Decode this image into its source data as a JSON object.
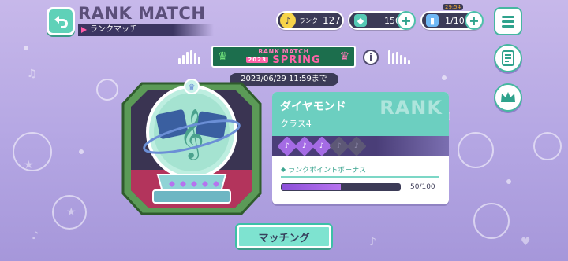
{
  "header": {
    "title": "RANK MATCH",
    "subtitle": "ランクマッチ"
  },
  "stats": {
    "rank_label": "ランク",
    "rank_value": "127",
    "crystals": "150",
    "live_bonus_timer": "29:54",
    "live_bonus": "1/10"
  },
  "season": {
    "banner_top": "RANK MATCH",
    "banner_year": "2023",
    "banner_bottom": "SPRING",
    "deadline": "2023/06/29 11:59まで"
  },
  "rank_card": {
    "watermark": "RANK",
    "tier": "ダイヤモンド",
    "class": "クラス4",
    "stars_filled": 3,
    "stars_total": 5,
    "bonus_label": "ランクポイントボーナス",
    "progress_text": "50/100",
    "progress_fraction": 0.5
  },
  "buttons": {
    "matching": "マッチング"
  },
  "colors": {
    "accent": "#5fd1b8",
    "card_head": "#6ccfc0",
    "strip": "#4a3e78",
    "progress": "#a46be4"
  }
}
